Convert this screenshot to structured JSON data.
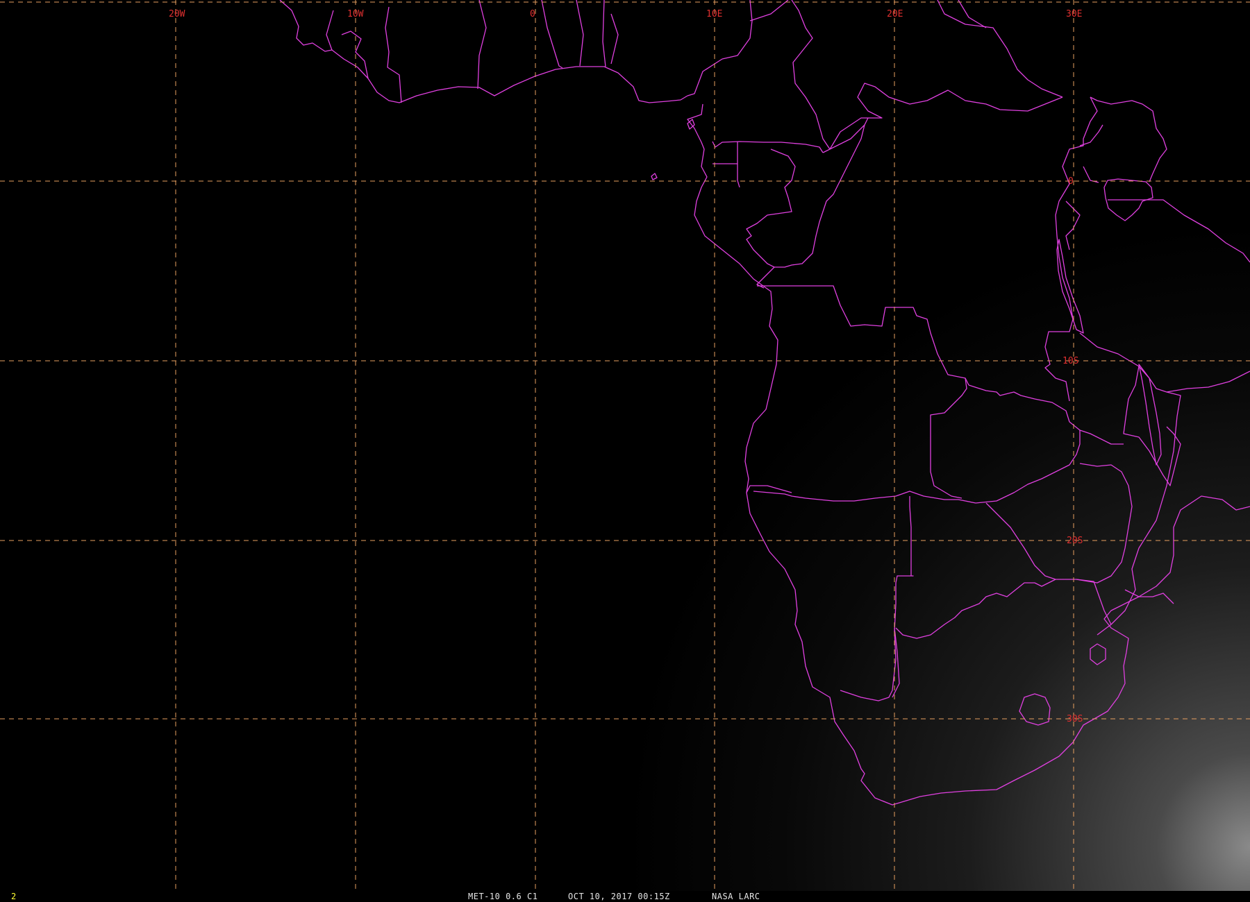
{
  "map": {
    "colors": {
      "background": "#000000",
      "grid": "#e8a060",
      "borders": "#e040e0",
      "grid_labels": "#e03030",
      "status_text": "#e6e6e6",
      "frame_number": "#ffff33"
    },
    "longitude_labels": [
      "20W",
      "10W",
      "0",
      "10E",
      "20E",
      "30E"
    ],
    "latitude_labels": [
      "0",
      "10S",
      "20S",
      "30S"
    ]
  },
  "status_bar": {
    "frame_number": "2",
    "satellite_channel": "MET-10 0.6 C1",
    "datetime": "OCT 10, 2017 00:15Z",
    "organization": "NASA LARC"
  }
}
